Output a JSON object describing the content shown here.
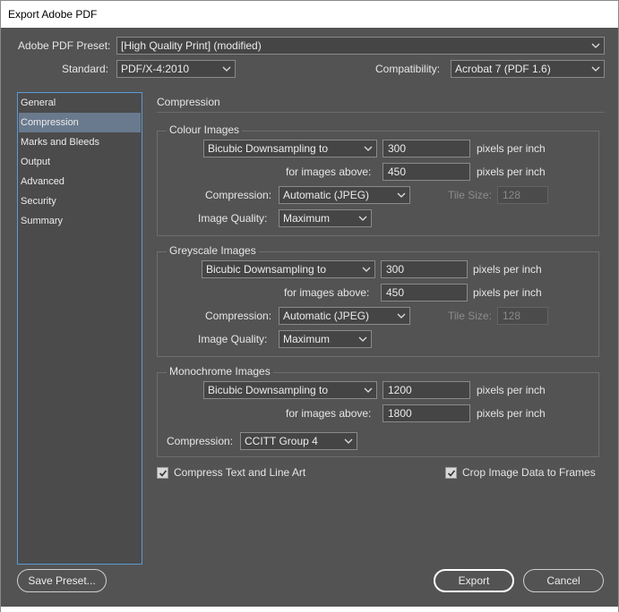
{
  "window": {
    "title": "Export Adobe PDF"
  },
  "header": {
    "preset_label": "Adobe PDF Preset:",
    "preset_value": "[High Quality Print] (modified)",
    "standard_label": "Standard:",
    "standard_value": "PDF/X-4:2010",
    "compat_label": "Compatibility:",
    "compat_value": "Acrobat 7 (PDF 1.6)"
  },
  "sidebar": {
    "items": [
      {
        "label": "General"
      },
      {
        "label": "Compression",
        "selected": true
      },
      {
        "label": "Marks and Bleeds"
      },
      {
        "label": "Output"
      },
      {
        "label": "Advanced"
      },
      {
        "label": "Security"
      },
      {
        "label": "Summary"
      }
    ]
  },
  "panel": {
    "title": "Compression",
    "colour": {
      "title": "Colour Images",
      "method": "Bicubic Downsampling to",
      "ppi": "300",
      "ppi_unit": "pixels per inch",
      "above_label": "for images above:",
      "above": "450",
      "above_unit": "pixels per inch",
      "compression_label": "Compression:",
      "compression": "Automatic (JPEG)",
      "tile_label": "Tile Size:",
      "tile": "128",
      "quality_label": "Image Quality:",
      "quality": "Maximum"
    },
    "greyscale": {
      "title": "Greyscale Images",
      "method": "Bicubic Downsampling to",
      "ppi": "300",
      "ppi_unit": "pixels per inch",
      "above_label": "for images above:",
      "above": "450",
      "above_unit": "pixels per inch",
      "compression_label": "Compression:",
      "compression": "Automatic (JPEG)",
      "tile_label": "Tile Size:",
      "tile": "128",
      "quality_label": "Image Quality:",
      "quality": "Maximum"
    },
    "mono": {
      "title": "Monochrome Images",
      "method": "Bicubic Downsampling to",
      "ppi": "1200",
      "ppi_unit": "pixels per inch",
      "above_label": "for images above:",
      "above": "1800",
      "above_unit": "pixels per inch",
      "compression_label": "Compression:",
      "compression": "CCITT Group 4"
    },
    "compress_text": {
      "label": "Compress Text and Line Art",
      "checked": true
    },
    "crop_image": {
      "label": "Crop Image Data to Frames",
      "checked": true
    }
  },
  "buttons": {
    "save_preset": "Save Preset...",
    "export": "Export",
    "cancel": "Cancel"
  },
  "colors": {
    "background": "#535353",
    "selection": "#6a7a8e",
    "sidebar_border": "#5b9bd5"
  },
  "icons": [
    "chevron-down-icon",
    "checkmark-icon"
  ]
}
